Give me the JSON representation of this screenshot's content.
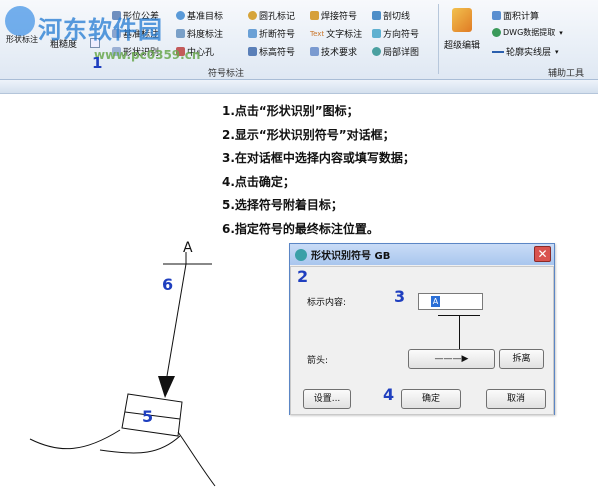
{
  "ribbon": {
    "left_big_1": "形状标注",
    "left_big_2": "粗糙度",
    "col1": [
      "形位公差",
      "基准标注",
      "形状识别"
    ],
    "col2": [
      "基准目标",
      "斜度标注",
      "中心孔"
    ],
    "col3": [
      "圆孔标记",
      "折断符号",
      "标高符号"
    ],
    "col4": [
      "焊接符号",
      "文字标注",
      "技术要求"
    ],
    "col5": [
      "剖切线",
      "方向符号",
      "局部详图"
    ],
    "group_label": "符号标注",
    "super_edit": "超级编辑",
    "col6": [
      "面积计算",
      "DWG数据提取",
      "轮廓实线层"
    ],
    "group_label_2": "辅助工具",
    "text_prefix": "Text"
  },
  "watermark": {
    "title": "河东软件园",
    "url": "www.pc0359.cn"
  },
  "instructions": [
    "1.点击“形状识别”图标；",
    "2.显示“形状识别符号”对话框；",
    "3.在对话框中选择内容或填写数据；",
    "4.点击确定；",
    "5.选择符号附着目标；",
    "6.指定符号的最终标注位置。"
  ],
  "callouts": {
    "c1": "1",
    "c2": "2",
    "c3": "3",
    "c4": "4",
    "c5": "5",
    "c6": "6"
  },
  "dialog": {
    "title": "形状识别符号 GB",
    "content_label": "标示内容:",
    "content_value": "A",
    "arrow_label": "箭头:",
    "arrow_button": "———▶",
    "separate_button": "拆离",
    "settings_button": "设置...",
    "ok_button": "确定",
    "cancel_button": "取消",
    "close_glyph": "✕"
  },
  "drawing": {
    "symbol_letter": "A"
  },
  "colors": {
    "callout": "#1f3fbf",
    "ribbon_bg": "#dfe8f3",
    "dialog_title": "#a9c6ee",
    "close": "#d9534f"
  }
}
